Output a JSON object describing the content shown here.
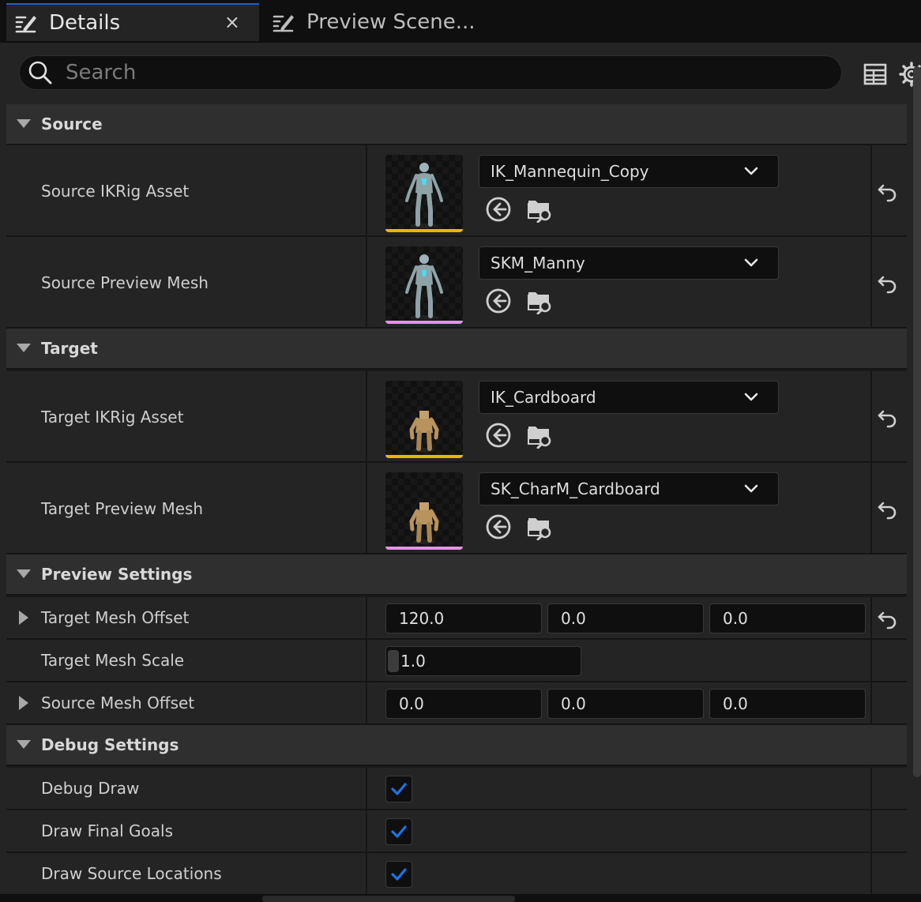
{
  "tabs": [
    {
      "label": "Details",
      "active": true,
      "close": "×"
    },
    {
      "label": "Preview Scene...",
      "active": false
    }
  ],
  "search": {
    "placeholder": "Search"
  },
  "colors": {
    "accent": "#1f5fc8",
    "ikrig_bar": "#e6b800",
    "mesh_bar": "#e591e6",
    "check": "#1b74e4"
  },
  "categories": {
    "source": {
      "label": "Source"
    },
    "target": {
      "label": "Target"
    },
    "preview": {
      "label": "Preview Settings"
    },
    "debug": {
      "label": "Debug Settings"
    }
  },
  "rows": {
    "source_ikrig": {
      "label": "Source IKRig Asset",
      "value": "IK_Mannequin_Copy"
    },
    "source_mesh": {
      "label": "Source Preview Mesh",
      "value": "SKM_Manny"
    },
    "target_ikrig": {
      "label": "Target IKRig Asset",
      "value": "IK_Cardboard"
    },
    "target_mesh": {
      "label": "Target Preview Mesh",
      "value": "SK_CharM_Cardboard"
    },
    "target_offset": {
      "label": "Target Mesh Offset",
      "x": "120.0",
      "y": "0.0",
      "z": "0.0"
    },
    "target_scale": {
      "label": "Target Mesh Scale",
      "value": "1.0"
    },
    "source_offset": {
      "label": "Source Mesh Offset",
      "x": "0.0",
      "y": "0.0",
      "z": "0.0"
    },
    "debug_draw": {
      "label": "Debug Draw",
      "checked": true
    },
    "draw_final_goals": {
      "label": "Draw Final Goals",
      "checked": true
    },
    "draw_source_locations": {
      "label": "Draw Source Locations",
      "checked": true
    }
  }
}
